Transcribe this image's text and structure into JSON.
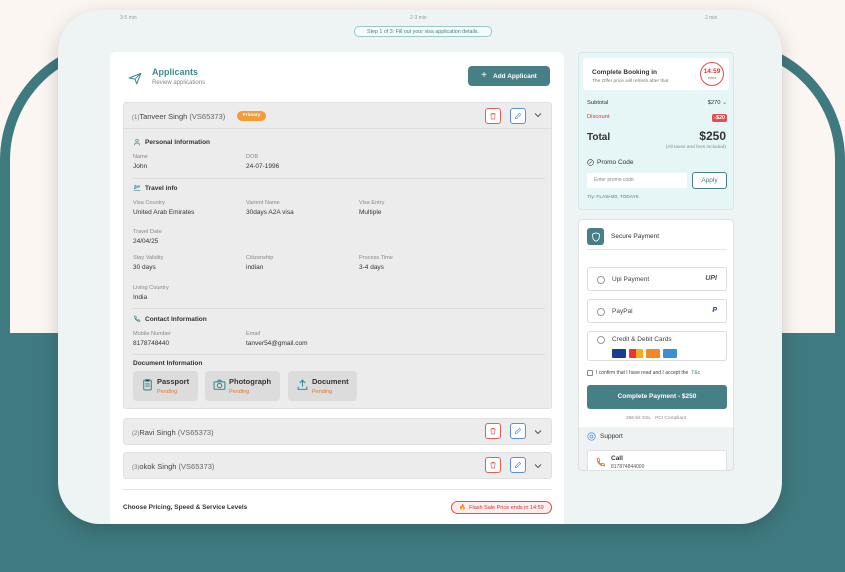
{
  "steps": {
    "left": "3-5 min",
    "center": "2-3 min",
    "right": "2 min"
  },
  "step_note": "Step 1 of 3: Fill out your visa application details.",
  "applicants": {
    "title": "Applicants",
    "subtitle": "Review applications",
    "add_label": "Add Applicant",
    "primary_badge": "Primary",
    "list": [
      {
        "num": "(1)",
        "name": "Tanveer Singh",
        "pid": "(VS65373)"
      },
      {
        "num": "(2)",
        "name": "Ravi Singh",
        "pid": "(VS65373)"
      },
      {
        "num": "(3)",
        "name": "okok Singh",
        "pid": "(VS65373)"
      }
    ],
    "personal": {
      "title": "Personal Information",
      "name_label": "Name",
      "name": "John",
      "dob_label": "DOB",
      "dob": "24-07-1996"
    },
    "travel": {
      "title": "Travel info",
      "country_label": "Visa Country",
      "country": "United Arab Emirates",
      "variant_label": "Varient Name",
      "variant": "30days A2A visa",
      "entry_label": "Visa Entry",
      "entry": "Multiple",
      "date_label": "Travel Date",
      "date": "24/04/25",
      "stay_label": "Stay Validity",
      "stay": "30 days",
      "citizen_label": "Citizenship",
      "citizen": "indian",
      "process_label": "Process Time",
      "process": "3-4 days",
      "living_label": "Living Country",
      "living": "India"
    },
    "contact": {
      "title": "Contact Information",
      "mobile_label": "Mobile Number",
      "mobile": "8178748440",
      "email_label": "Email",
      "email": "tanver54@gmail.com"
    },
    "documents": {
      "title": "Document Information",
      "items": [
        {
          "name": "Passport",
          "status": "Pending"
        },
        {
          "name": "Photograph",
          "status": "Pending"
        },
        {
          "name": "Document",
          "status": "Pending"
        }
      ]
    }
  },
  "pricing": {
    "title": "Choose Pricing, Speed & Service Levels",
    "flash": "Flash Sale Price ends in 14:59"
  },
  "booking": {
    "title": "Complete Booking in",
    "subtitle": "The Offer price will refresh after that",
    "timer": "14:59",
    "timer_unit": "mins",
    "subtotal_label": "Subtotal",
    "subtotal": "$270",
    "discount_label": "Discount",
    "discount": "-$20",
    "total_label": "Total",
    "total": "$250",
    "total_note": "(All taxes and fees included)",
    "promo_label": "Promo Code",
    "promo_placeholder": "Enter promo code",
    "apply_label": "Apply",
    "try_text": "Try: FLASH20, TODAY5"
  },
  "payment": {
    "title": "Secure Payment",
    "options": [
      {
        "label": "Upi Payment",
        "logo": "UPI"
      },
      {
        "label": "PayPal",
        "logo": "P"
      },
      {
        "label": "Credit & Debit Cards"
      }
    ],
    "confirm_text": "I confirm that I have read and I accept the",
    "confirm_link": "T&c",
    "complete_label": "Complete Payment - $250",
    "secure_note": "256-bit SSL  ·  PCI Compliant",
    "support_title": "Support",
    "call_label": "Call",
    "call_number": "817874844000"
  },
  "colors": {
    "accent": "#477f86",
    "band": "#3f7a80",
    "danger": "#e34d4d",
    "pending": "#e0752f"
  }
}
